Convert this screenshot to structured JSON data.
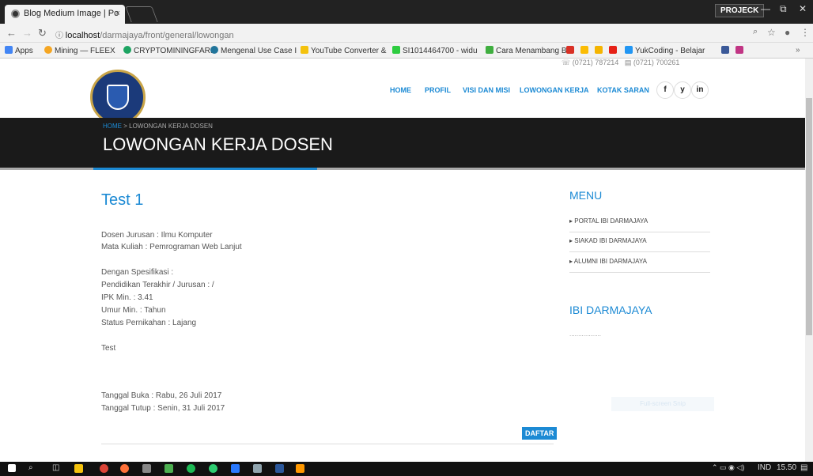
{
  "browser": {
    "tab_title": "Blog Medium Image | Po",
    "tab_close": "×",
    "profile_label": "PROJECK",
    "window_controls": [
      "—",
      "⧉",
      "✕"
    ],
    "url_host": "localhost",
    "url_path": "/darmajaya/front/general/lowongan",
    "bookmarks": [
      {
        "label": "Apps",
        "color": "#4285f4"
      },
      {
        "label": "Mining — FLEEX",
        "color": "#f5a623"
      },
      {
        "label": "CRYPTOMININGFARI",
        "color": "#1da462"
      },
      {
        "label": "Mengenal Use Case I",
        "color": "#21759b"
      },
      {
        "label": "YouTube Converter &",
        "color": "#f4c20d"
      },
      {
        "label": "SI1014464700 - widu",
        "color": "#2ecc40"
      },
      {
        "label": "Cara Menambang Bit",
        "color": "#3fae3f"
      },
      {
        "label": "YukCoding - Belajar",
        "color": "#2196f3"
      }
    ]
  },
  "site": {
    "contact_phone": "(0721) 787214",
    "contact_fax": "(0721) 700261",
    "nav": [
      "HOME",
      "PROFIL",
      "VISI DAN MISI",
      "LOWONGAN KERJA",
      "KOTAK SARAN"
    ],
    "social": [
      "f",
      "y",
      "in"
    ],
    "breadcrumb_home": "HOME",
    "breadcrumb_sep": ">",
    "breadcrumb_current": "LOWONGAN KERJA DOSEN",
    "page_title": "LOWONGAN KERJA DOSEN"
  },
  "job": {
    "title": "Test 1",
    "jurusan": "Dosen Jurusan : Ilmu Komputer",
    "matkul": "Mata Kuliah : Pemrograman Web Lanjut",
    "spec_heading": "Dengan Spesifikasi :",
    "pendidikan": "Pendidikan Terakhir / Jurusan : /",
    "ipk": "IPK Min. : 3.41",
    "umur": "Umur Min. : Tahun",
    "status": "Status Pernikahan : Lajang",
    "desc": "Test",
    "tanggal_buka": "Tanggal Buka : Rabu, 26 Juli 2017",
    "tanggal_tutup": "Tanggal Tutup : Senin, 31 Juli 2017",
    "apply_label": "DAFTAR"
  },
  "sidebar": {
    "menu_heading": "MENU",
    "items": [
      "PORTAL IBI DARMAJAYA",
      "SIAKAD IBI DARMAJAYA",
      "ALUMNI IBI DARMAJAYA"
    ],
    "about_heading": "IBI DARMAJAYA",
    "about_text": "..................",
    "fullscreen_label": "Full-screen Snip"
  },
  "taskbar": {
    "tray_lang": "IND",
    "clock": "15.50"
  }
}
